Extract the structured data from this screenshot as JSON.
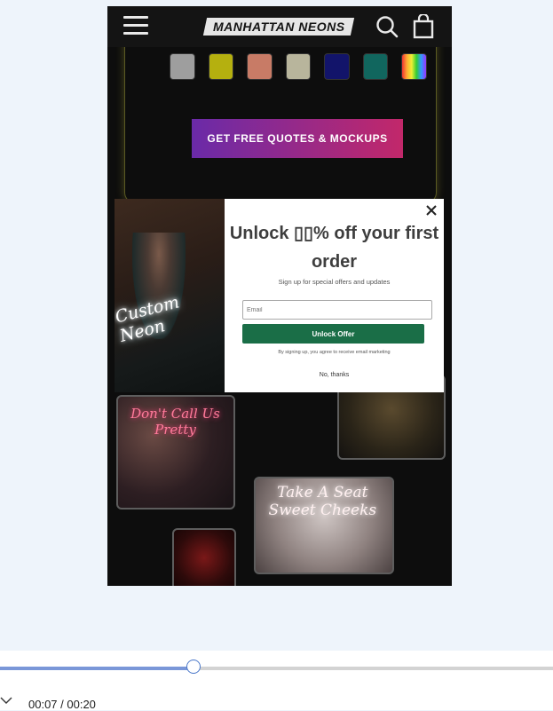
{
  "header": {
    "logo_text": "MANHATTAN NEONS",
    "icons": [
      "menu-icon",
      "search-icon",
      "cart-icon"
    ]
  },
  "swatches": {
    "top_row": [
      "#d6699a",
      "#c5b92a",
      "#d25c42",
      "#58a3c5",
      "#58b25a",
      "#d79cb8",
      "#7a3fd0"
    ],
    "bottom_row": [
      "#9e9e9e",
      "#b5b00f",
      "#c87b66",
      "#b8b59c",
      "#12146a",
      "#11665e",
      "rainbow"
    ]
  },
  "cta": {
    "label": "GET FREE QUOTES & MOCKUPS"
  },
  "photos": {
    "p1_text": "Don't Call Us Pretty",
    "p2_text": "Take A Seat Sweet Cheeks"
  },
  "popup": {
    "image_sign": "Custom Neon",
    "title": "Unlock ▯▯% off your first order",
    "subtitle": "Sign up for special offers and updates",
    "email_placeholder": "Email",
    "button_label": "Unlock Offer",
    "legal": "By signing up, you agree to receive email marketing",
    "decline": "No, thanks"
  },
  "player": {
    "time": "00:07 / 00:20",
    "progress": 0.35
  }
}
